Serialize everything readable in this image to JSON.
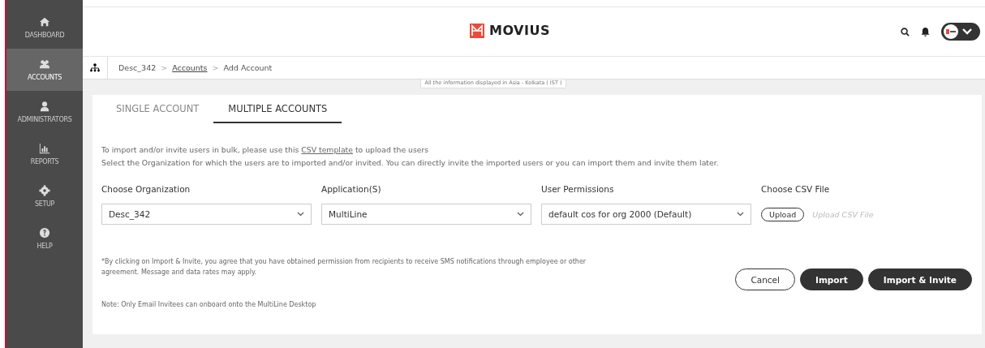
{
  "sidebar": {
    "items": [
      {
        "label": "DASHBOARD",
        "selected": false
      },
      {
        "label": "ACCOUNTS",
        "selected": true
      },
      {
        "label": "ADMINISTRATORS",
        "selected": false
      },
      {
        "label": "REPORTS",
        "selected": false
      },
      {
        "label": "SETUP",
        "selected": false
      },
      {
        "label": "HELP",
        "selected": false
      }
    ]
  },
  "header": {
    "logo_text": "MOVIUS"
  },
  "breadcrumb": [
    {
      "kind": "item",
      "label": "Desc_342",
      "link": false
    },
    {
      "kind": "separator",
      "label": ">"
    },
    {
      "kind": "item",
      "label": "Accounts",
      "link": true
    },
    {
      "kind": "separator",
      "label": ">"
    },
    {
      "kind": "item",
      "label": "Add Account",
      "link": false
    }
  ],
  "timezone_note": "All the information displayed in Asia - Kolkata ( IST )",
  "tabs": [
    {
      "label": "SINGLE ACCOUNT",
      "selected": false
    },
    {
      "label": "MULTIPLE ACCOUNTS",
      "selected": true
    }
  ],
  "intro": {
    "before": "To import and/or invite users in bulk, please use this",
    "link": "CSV template",
    "after": "to upload the users",
    "line_2": "Select the Organization for which the users are to imported and/or invited. You can directly invite the imported users or you can import them and invite them later."
  },
  "fields": [
    {
      "kind": "select",
      "label": "Choose Organization",
      "value": "Desc_342"
    },
    {
      "kind": "select",
      "label": "Application(S)",
      "value": "MultiLine"
    },
    {
      "kind": "select",
      "label": "User Permissions",
      "value": "default cos for org 2000 (Default)"
    },
    {
      "kind": "file",
      "label": "Choose CSV File",
      "button": "Upload",
      "placeholder": "Upload CSV File"
    }
  ],
  "disclaimer": "*By clicking on Import & Invite, you agree that you have obtained permission from recipients to receive SMS notifications through employee or other agreement. Message and data rates may apply.",
  "note": "Note: Only Email Invitees can onboard onto the MultiLine Desktop",
  "buttons": [
    {
      "label": "Cancel",
      "kind": "outline"
    },
    {
      "label": "Import",
      "kind": "primary"
    },
    {
      "label": "Import & Invite",
      "kind": "primary"
    }
  ]
}
